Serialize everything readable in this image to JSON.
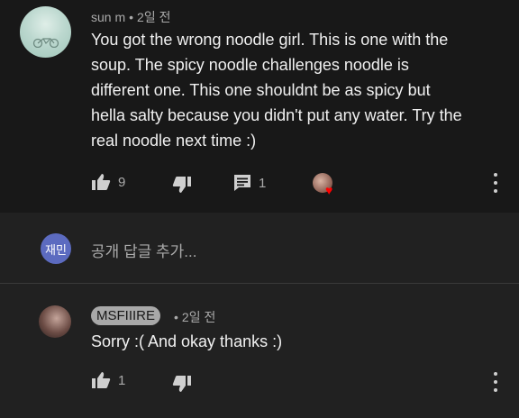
{
  "comment": {
    "author": "sun m",
    "time": "2일 전",
    "text": "You got the wrong noodle girl. This is one with the\nsoup. The spicy noodle challenges  noodle is\ndifferent one. This one shouldnt be as spicy but\nhella salty because you didn't put any water. Try the\nreal noodle next time :)",
    "likes": "9",
    "replies": "1",
    "icons": [
      "thumb-up-icon",
      "thumb-down-icon",
      "reply-icon",
      "creator-heart-icon",
      "more-vert-icon"
    ]
  },
  "reply_box": {
    "avatar_text": "재민",
    "placeholder": "공개 답글 추가..."
  },
  "reply": {
    "author": "MSFIIIRE",
    "time": "2일 전",
    "text": "Sorry :( And okay thanks :)",
    "likes": "1"
  },
  "colors": {
    "top_background": "#181818",
    "bottom_background": "#212121",
    "text": "#f1f1f1",
    "secondary_text": "#aaaaaa",
    "heart": "#ff0000",
    "avatar_accent": "#5c6bc0"
  }
}
